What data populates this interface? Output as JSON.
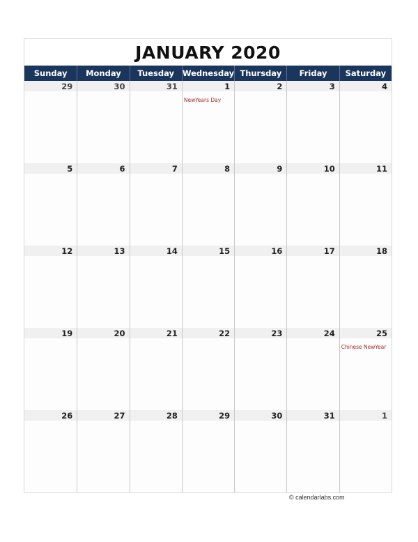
{
  "title": "JANUARY 2020",
  "weekdays": [
    "Sunday",
    "Monday",
    "Tuesday",
    "Wednesday",
    "Thursday",
    "Friday",
    "Saturday"
  ],
  "weeks": [
    [
      {
        "day": "29",
        "other": true
      },
      {
        "day": "30",
        "other": true
      },
      {
        "day": "31",
        "other": true
      },
      {
        "day": "1",
        "event": "NewYears Day"
      },
      {
        "day": "2"
      },
      {
        "day": "3"
      },
      {
        "day": "4"
      }
    ],
    [
      {
        "day": "5"
      },
      {
        "day": "6"
      },
      {
        "day": "7"
      },
      {
        "day": "8"
      },
      {
        "day": "9"
      },
      {
        "day": "10"
      },
      {
        "day": "11"
      }
    ],
    [
      {
        "day": "12"
      },
      {
        "day": "13"
      },
      {
        "day": "14"
      },
      {
        "day": "15"
      },
      {
        "day": "16"
      },
      {
        "day": "17"
      },
      {
        "day": "18"
      }
    ],
    [
      {
        "day": "19"
      },
      {
        "day": "20"
      },
      {
        "day": "21"
      },
      {
        "day": "22"
      },
      {
        "day": "23"
      },
      {
        "day": "24"
      },
      {
        "day": "25",
        "event": "Chinese NewYear"
      }
    ],
    [
      {
        "day": "26"
      },
      {
        "day": "27"
      },
      {
        "day": "28"
      },
      {
        "day": "29"
      },
      {
        "day": "30"
      },
      {
        "day": "31"
      },
      {
        "day": "1",
        "other": true
      }
    ]
  ],
  "footer": "© calendarlabs.com",
  "colors": {
    "header_bg": "#1b365d",
    "event_text": "#a62b2b",
    "date_bar": "#f0f0f0"
  }
}
